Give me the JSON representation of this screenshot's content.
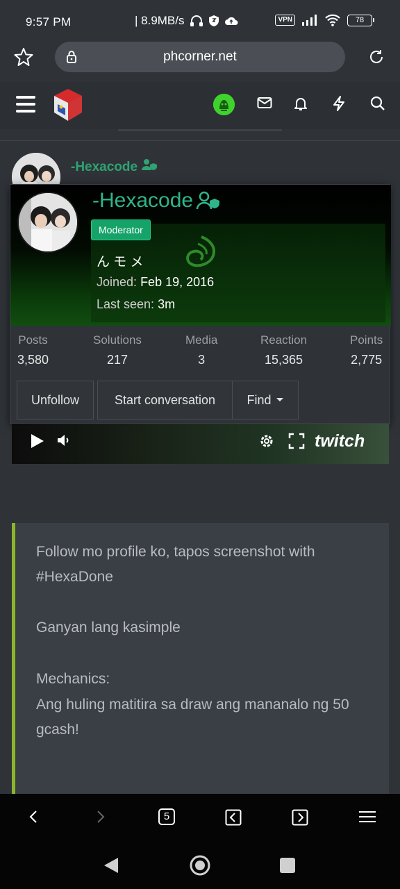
{
  "status_bar": {
    "time": "9:57 PM",
    "speed": "| 8.9MB/s",
    "vpn": "VPN",
    "battery": "78"
  },
  "browser": {
    "url": "phcorner.net",
    "icons": [
      "star-icon",
      "lock-icon",
      "reload-icon"
    ]
  },
  "header": {
    "icons": [
      "menu-icon",
      "site-logo",
      "user-avatar",
      "mail-icon",
      "bell-icon",
      "bolt-icon",
      "search-icon"
    ]
  },
  "post": {
    "username": "-Hexacode"
  },
  "profile_popup": {
    "username": "-Hexacode",
    "badge": "Moderator",
    "custom_title": "ん モ メ",
    "joined_label": "Joined:",
    "joined_value": "Feb 19, 2016",
    "lastseen_label": "Last seen:",
    "lastseen_value": "3m",
    "stats": [
      {
        "label": "Posts",
        "value": "3,580"
      },
      {
        "label": "Solutions",
        "value": "217"
      },
      {
        "label": "Media",
        "value": "3"
      },
      {
        "label": "Reaction",
        "value": "15,365"
      },
      {
        "label": "Points",
        "value": "2,775"
      }
    ],
    "actions": {
      "unfollow": "Unfollow",
      "start_conversation": "Start conversation",
      "find": "Find"
    }
  },
  "video": {
    "brand": "twitch"
  },
  "post_body": {
    "line1": "Follow mo profile ko, tapos screenshot with #HexaDone",
    "line2": "Ganyan lang kasimple",
    "line3": "Mechanics:",
    "line4": "Ang huling matitira sa draw ang mananalo ng 50 gcash!"
  },
  "bottom_nav": {
    "tabs_count": "5"
  },
  "colors": {
    "accent_green": "#2fb58a",
    "badge_green": "#16a36a",
    "quote_bar": "#8bb52a"
  }
}
